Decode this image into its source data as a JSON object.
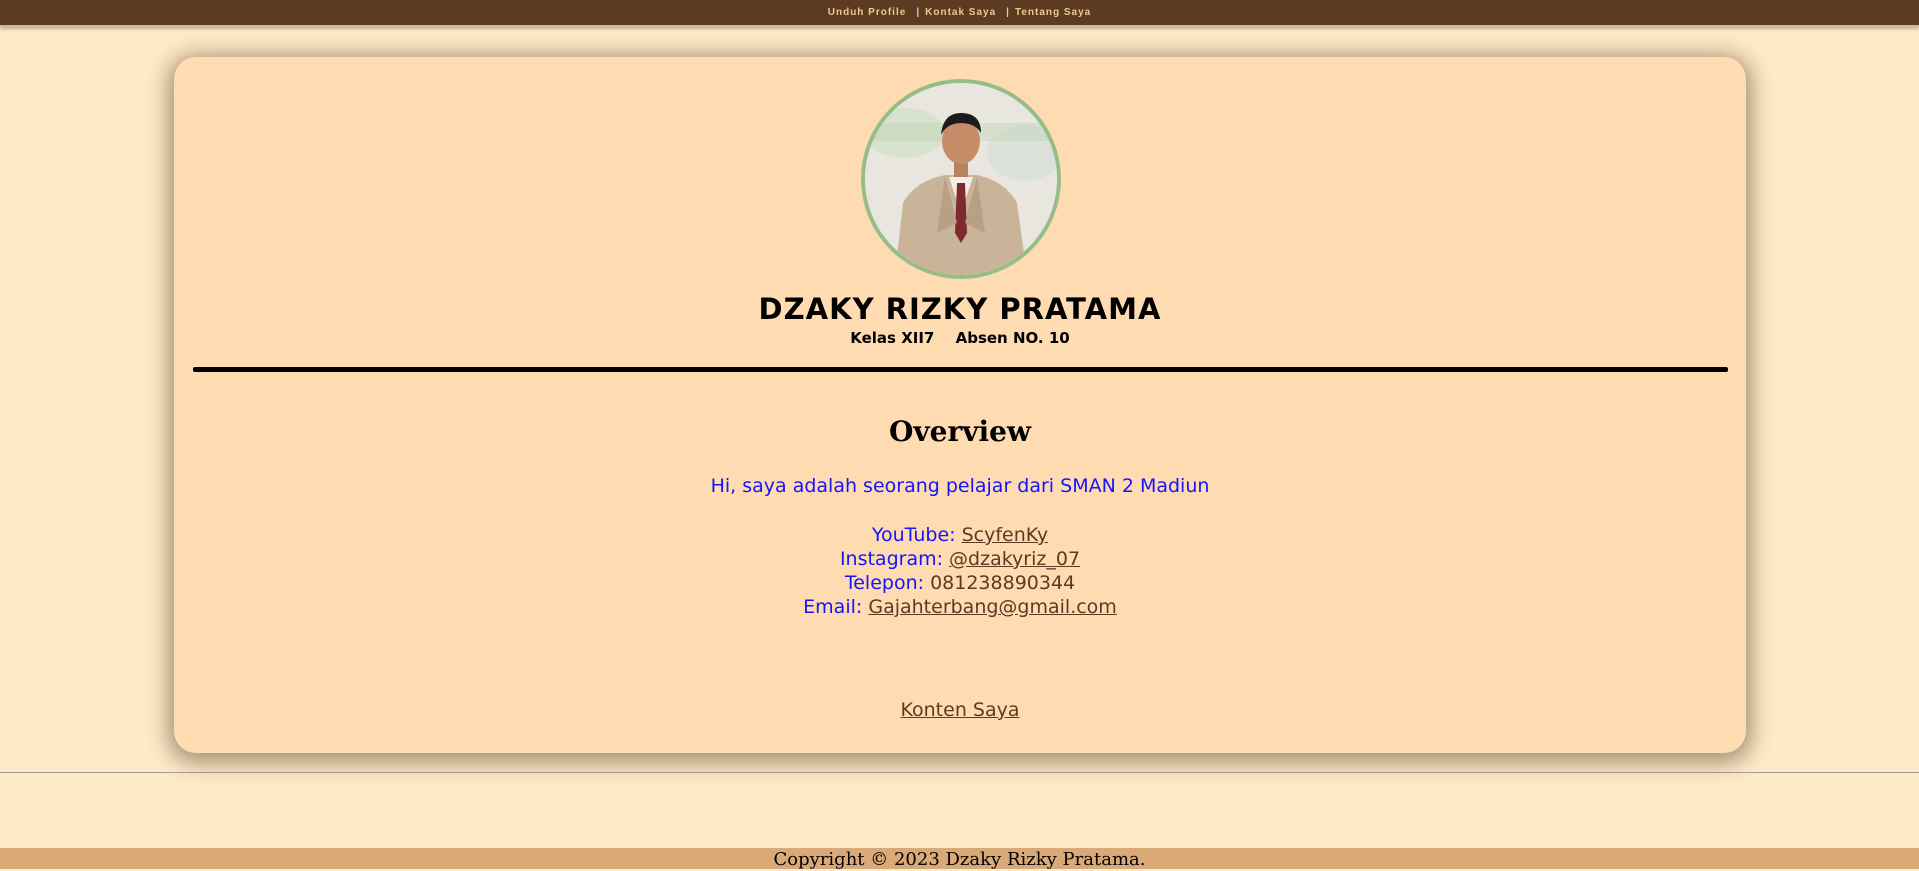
{
  "nav": {
    "items": [
      {
        "label": "Unduh Profile"
      },
      {
        "label": "Kontak Saya"
      },
      {
        "label": "Tentang Saya"
      }
    ],
    "separator": "|"
  },
  "profile": {
    "name": "DZAKY RIZKY PRATAMA",
    "kelas": "Kelas XII7",
    "absen": "Absen NO. 10",
    "avatar_icon": "profile-photo"
  },
  "overview": {
    "title": "Overview",
    "intro": "Hi, saya adalah seorang pelajar dari SMAN 2 Madiun",
    "contacts": [
      {
        "label": "YouTube:",
        "value": "ScyfenKy",
        "is_link": true
      },
      {
        "label": "Instagram:",
        "value": "@dzakyriz_07",
        "is_link": true
      },
      {
        "label": "Telepon:",
        "value": "081238890344",
        "is_link": false
      },
      {
        "label": "Email:",
        "value": "Gajahterbang@gmail.com",
        "is_link": true
      }
    ],
    "content_link": "Konten Saya"
  },
  "footer": {
    "copyright": "Copyright © 2023 Dzaky Rizky Pratama."
  },
  "colors": {
    "page_bg": "#ffeac8",
    "nav_bg": "#5c3b22",
    "nav_text": "#f0c98e",
    "card_bg": "#ffdbb2",
    "accent_blue": "#1414ff",
    "link_brown": "#5c3b22",
    "avatar_border": "#96bd88",
    "footer_bg": "#d9aa78"
  }
}
